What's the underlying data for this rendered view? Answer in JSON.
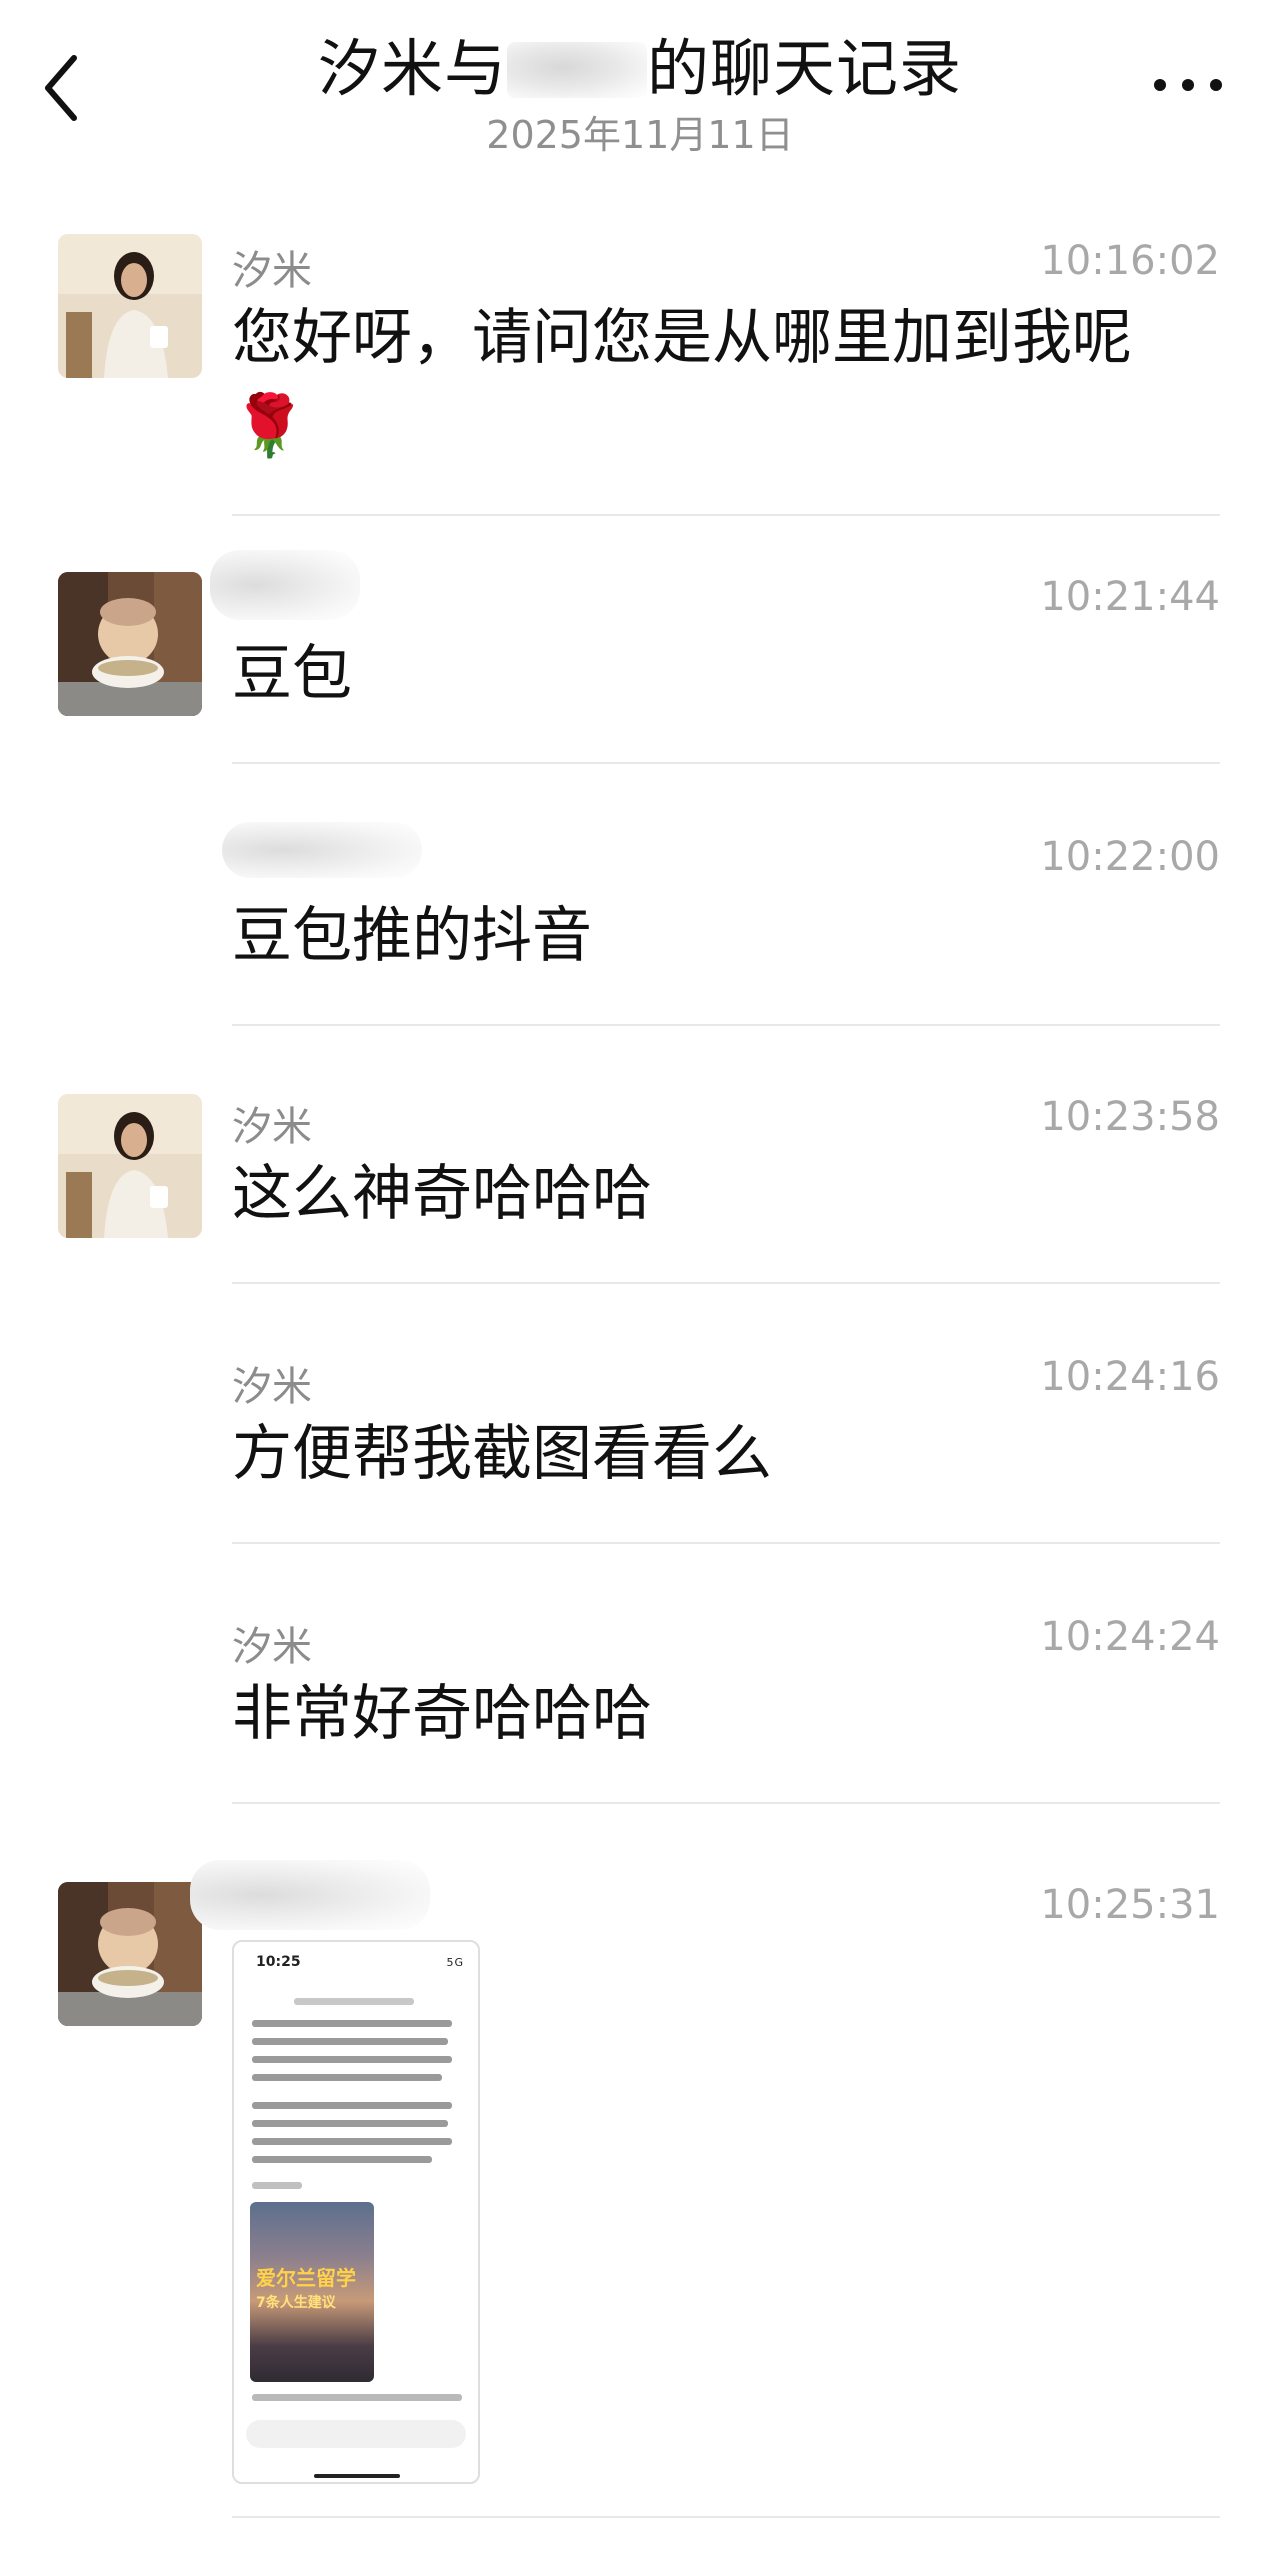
{
  "header": {
    "title_prefix": "汐米与",
    "title_suffix": "的聊天记录",
    "date": "2025年11月11日"
  },
  "messages": [
    {
      "sender": "汐米",
      "time": "10:16:02",
      "text": "您好呀，请问您是从哪里加到我呢",
      "emoji": "🌹",
      "avatar": "woman-avatar"
    },
    {
      "sender": "",
      "time": "10:21:44",
      "text": "豆包",
      "avatar": "child-avatar"
    },
    {
      "sender": "",
      "time": "10:22:00",
      "text": "豆包推的抖音"
    },
    {
      "sender": "汐米",
      "time": "10:23:58",
      "text": "这么神奇哈哈哈",
      "avatar": "woman-avatar"
    },
    {
      "sender": "汐米",
      "time": "10:24:16",
      "text": "方便帮我截图看看么"
    },
    {
      "sender": "汐米",
      "time": "10:24:24",
      "text": "非常好奇哈哈哈"
    },
    {
      "sender": "",
      "time": "10:25:31",
      "text": "",
      "attachment": "screenshot-image",
      "avatar": "child-avatar",
      "screenshot": {
        "status_time": "10:25",
        "status_icons": "5G",
        "video_title_1": "爱尔兰留学",
        "video_title_2": "7条人生建议"
      }
    }
  ]
}
